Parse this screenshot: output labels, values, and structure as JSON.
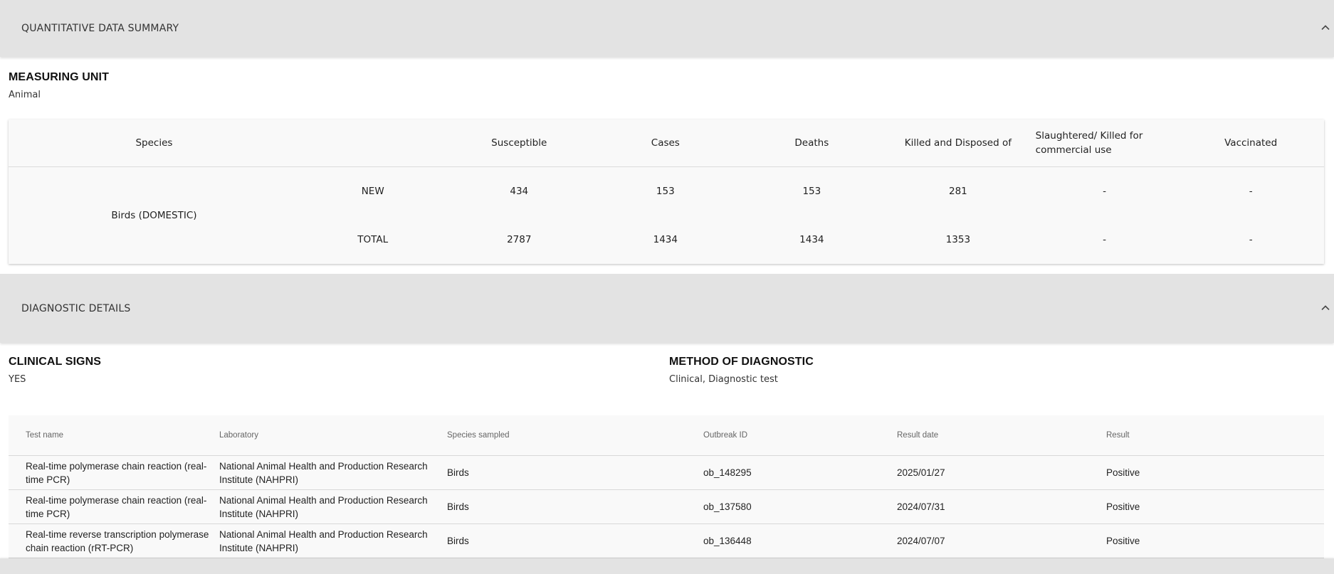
{
  "quantitative": {
    "header_title": "QUANTITATIVE DATA SUMMARY",
    "measuring_unit_label": "MEASURING UNIT",
    "measuring_unit_value": "Animal",
    "columns": {
      "species": "Species",
      "susceptible": "Susceptible",
      "cases": "Cases",
      "deaths": "Deaths",
      "killed_disposed": "Killed and Disposed of",
      "slaughtered": "Slaughtered/ Killed for commercial use",
      "vaccinated": "Vaccinated"
    },
    "species_name": "Birds (DOMESTIC)",
    "rows": [
      {
        "type": "NEW",
        "susceptible": "434",
        "cases": "153",
        "deaths": "153",
        "killed_disposed": "281",
        "slaughtered": "-",
        "vaccinated": "-"
      },
      {
        "type": "TOTAL",
        "susceptible": "2787",
        "cases": "1434",
        "deaths": "1434",
        "killed_disposed": "1353",
        "slaughtered": "-",
        "vaccinated": "-"
      }
    ]
  },
  "diagnostic": {
    "header_title": "DIAGNOSTIC DETAILS",
    "clinical_signs_label": "CLINICAL SIGNS",
    "clinical_signs_value": "YES",
    "method_label": "METHOD OF DIAGNOSTIC",
    "method_value": "Clinical, Diagnostic test",
    "tests_columns": {
      "test_name": "Test name",
      "laboratory": "Laboratory",
      "species_sampled": "Species sampled",
      "outbreak_id": "Outbreak ID",
      "result_date": "Result date",
      "result": "Result"
    },
    "tests": [
      {
        "test_name": "Real-time polymerase chain reaction (real-time PCR)",
        "laboratory": "National Animal Health and Production Research Institute (NAHPRI)",
        "species_sampled": "Birds",
        "outbreak_id": "ob_148295",
        "result_date": "2025/01/27",
        "result": "Positive"
      },
      {
        "test_name": "Real-time polymerase chain reaction (real-time PCR)",
        "laboratory": "National Animal Health and Production Research Institute (NAHPRI)",
        "species_sampled": "Birds",
        "outbreak_id": "ob_137580",
        "result_date": "2024/07/31",
        "result": "Positive"
      },
      {
        "test_name": "Real-time reverse transcription polymerase chain reaction (rRT-PCR)",
        "laboratory": "National Animal Health and Production Research Institute (NAHPRI)",
        "species_sampled": "Birds",
        "outbreak_id": "ob_136448",
        "result_date": "2024/07/07",
        "result": "Positive"
      }
    ]
  },
  "icons": {
    "collapse": "chevron-up-icon"
  }
}
